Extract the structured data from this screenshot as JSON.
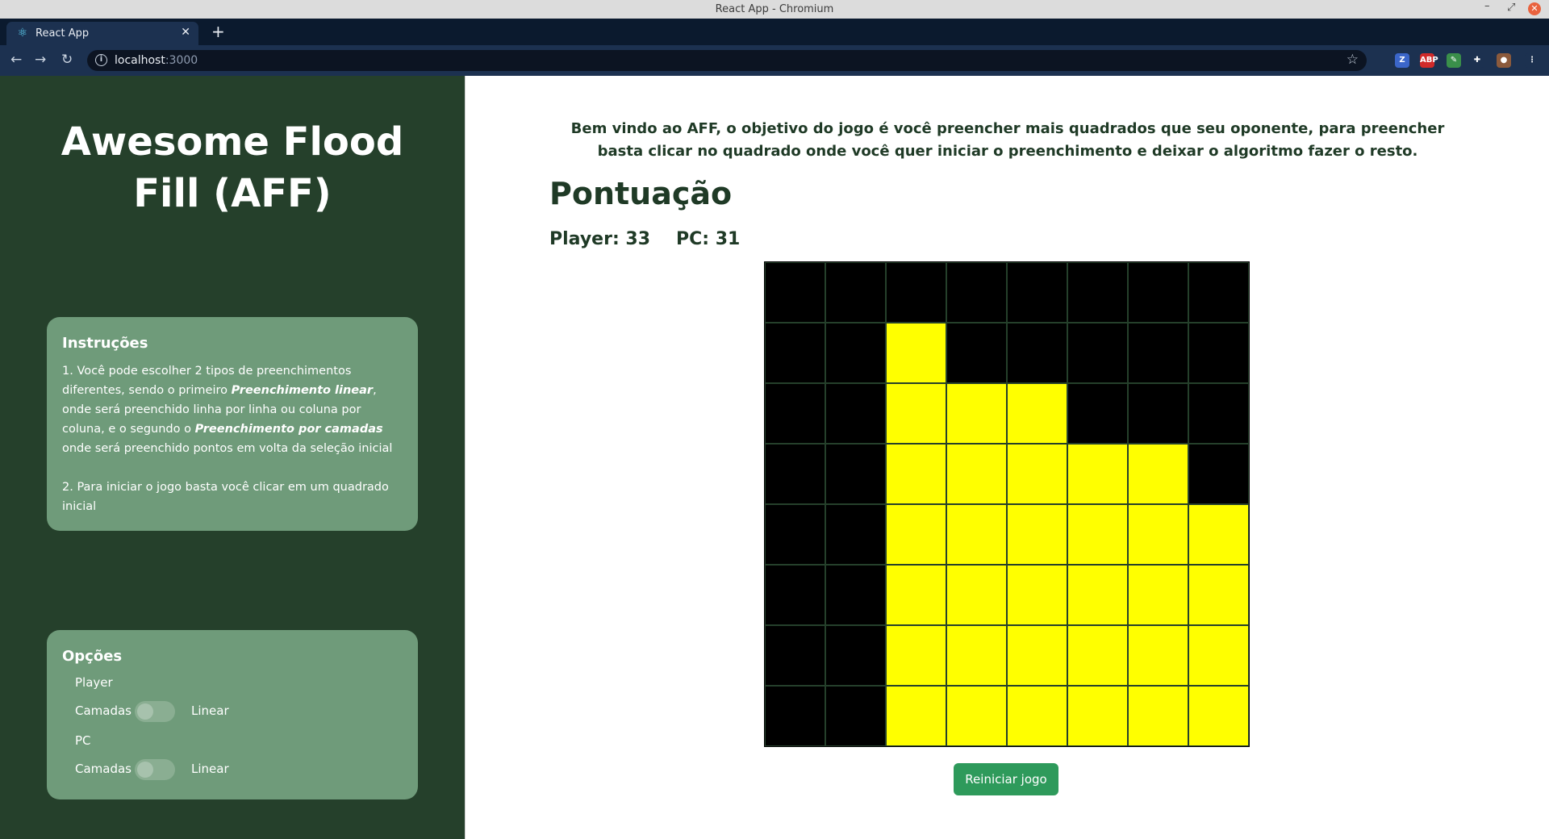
{
  "window": {
    "title": "React App - Chromium"
  },
  "browser": {
    "tab_title": "React App",
    "url_host": "localhost",
    "url_port": ":3000",
    "extensions": [
      {
        "name": "z-extension-icon",
        "label": "Z",
        "color": "#3b66c9"
      },
      {
        "name": "adblock-icon",
        "label": "ABP",
        "color": "#d02a2a"
      },
      {
        "name": "dropper-extension-icon",
        "label": "✎",
        "color": "#3a8f4a"
      },
      {
        "name": "puzzle-extensions-icon",
        "label": "✚",
        "color": "#1c3150"
      },
      {
        "name": "profile-avatar",
        "label": "●",
        "color": "#8b5a3c"
      },
      {
        "name": "menu-dots-icon",
        "label": "⋮",
        "color": "#1c3150"
      }
    ]
  },
  "sidebar": {
    "app_title": "Awesome Flood Fill (AFF)",
    "instructions": {
      "heading": "Instruções",
      "p1_a": "1. Você pode escolher 2 tipos de preenchimentos diferentes, sendo o primeiro ",
      "p1_b": "Preenchimento linear",
      "p1_c": ", onde será preenchido linha por linha ou coluna por coluna, e o segundo o ",
      "p1_d": "Preenchimento por camadas",
      "p1_e": " onde será preenchido pontos em volta da seleção inicial",
      "p2": "2. Para iniciar o jogo basta você clicar em um quadrado inicial"
    },
    "options": {
      "heading": "Opções",
      "player_label": "Player",
      "pc_label": "PC",
      "left_option": "Camadas",
      "right_option": "Linear",
      "player_mode": "Camadas",
      "pc_mode": "Camadas"
    }
  },
  "main": {
    "welcome": "Bem vindo ao AFF, o objetivo do jogo é você preencher mais quadrados que seu oponente, para preencher basta clicar no quadrado onde você quer iniciar o preenchimento e deixar o algoritmo fazer o resto.",
    "score_title": "Pontuação",
    "player_score": "Player: 33",
    "pc_score": "PC: 31",
    "restart_label": "Reiniciar jogo",
    "colors": {
      "player": "#ffff00",
      "pc": "#000000"
    },
    "board": [
      [
        "pc",
        "pc",
        "pc",
        "pc",
        "pc",
        "pc",
        "pc",
        "pc"
      ],
      [
        "pc",
        "pc",
        "player",
        "pc",
        "pc",
        "pc",
        "pc",
        "pc"
      ],
      [
        "pc",
        "pc",
        "player",
        "player",
        "player",
        "pc",
        "pc",
        "pc"
      ],
      [
        "pc",
        "pc",
        "player",
        "player",
        "player",
        "player",
        "player",
        "pc"
      ],
      [
        "pc",
        "pc",
        "player",
        "player",
        "player",
        "player",
        "player",
        "player"
      ],
      [
        "pc",
        "pc",
        "player",
        "player",
        "player",
        "player",
        "player",
        "player"
      ],
      [
        "pc",
        "pc",
        "player",
        "player",
        "player",
        "player",
        "player",
        "player"
      ],
      [
        "pc",
        "pc",
        "player",
        "player",
        "player",
        "player",
        "player",
        "player"
      ]
    ]
  }
}
